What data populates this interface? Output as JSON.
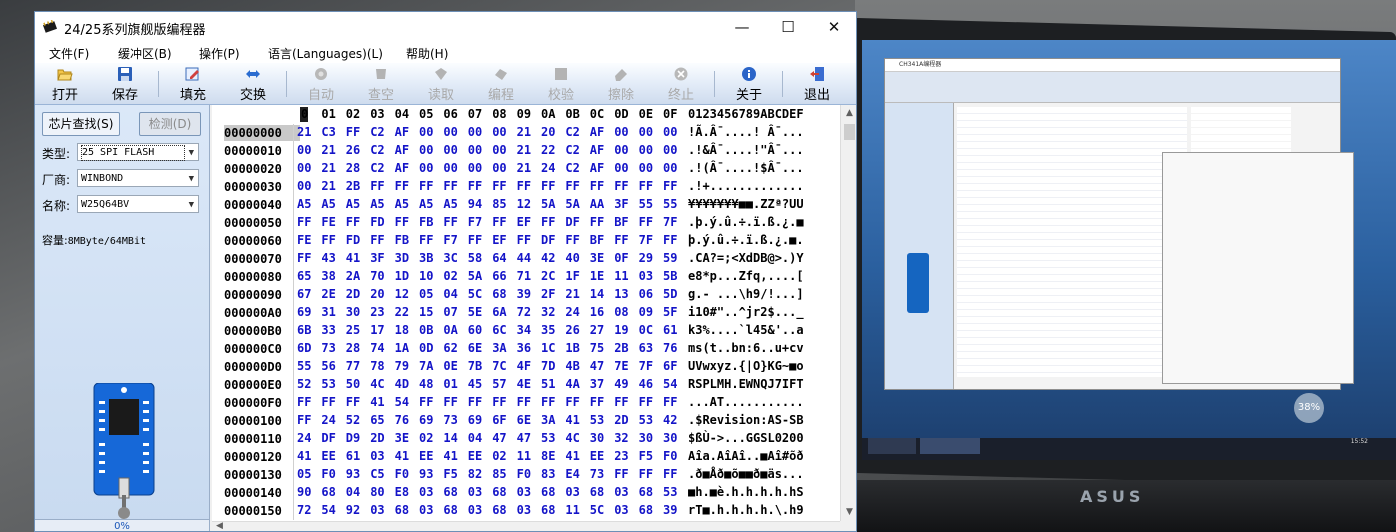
{
  "window": {
    "title": "24/25系列旗舰版编程器",
    "minimize": "—",
    "maximize": "☐",
    "close": "✕"
  },
  "menu": [
    "文件(F)",
    "缓冲区(B)",
    "操作(P)",
    "语言(Languages)(L)",
    "帮助(H)"
  ],
  "toolbar": [
    {
      "label": "打开",
      "icon": "open-folder-icon",
      "enabled": true
    },
    {
      "label": "保存",
      "icon": "save-icon",
      "enabled": true
    },
    {
      "label": "填充",
      "icon": "fill-icon",
      "enabled": true
    },
    {
      "label": "交换",
      "icon": "swap-icon",
      "enabled": true
    },
    {
      "label": "自动",
      "icon": "auto-icon",
      "enabled": false
    },
    {
      "label": "查空",
      "icon": "blank-check-icon",
      "enabled": false
    },
    {
      "label": "读取",
      "icon": "read-icon",
      "enabled": false
    },
    {
      "label": "编程",
      "icon": "program-icon",
      "enabled": false
    },
    {
      "label": "校验",
      "icon": "verify-icon",
      "enabled": false
    },
    {
      "label": "擦除",
      "icon": "erase-icon",
      "enabled": false
    },
    {
      "label": "终止",
      "icon": "stop-icon",
      "enabled": false
    },
    {
      "label": "关于",
      "icon": "info-icon",
      "enabled": true
    },
    {
      "label": "退出",
      "icon": "exit-icon",
      "enabled": true
    }
  ],
  "left_panel": {
    "search_button": "芯片查找(S)",
    "detect_button": "检测(D)",
    "type_label": "类型:",
    "type_value": "25 SPI FLASH",
    "vendor_label": "厂商:",
    "vendor_value": "WINBOND",
    "name_label": "名称:",
    "name_value": "W25Q64BV",
    "capacity_label": "容量:",
    "capacity_value": "8MByte/64MBit",
    "progress": "0%"
  },
  "hex": {
    "columns": [
      "0",
      "01",
      "02",
      "03",
      "04",
      "05",
      "06",
      "07",
      "08",
      "09",
      "0A",
      "0B",
      "0C",
      "0D",
      "0E",
      "0F"
    ],
    "ascii_header": "0123456789ABCDEF",
    "selected_address": "00000000",
    "rows": [
      {
        "addr": "00000000",
        "bytes": "21 C3 FF C2 AF 00 00 00 00 21 20 C2 AF 00 00 00",
        "ascii": "!Ã.Â¯....! Â¯..."
      },
      {
        "addr": "00000010",
        "bytes": "00 21 26 C2 AF 00 00 00 00 21 22 C2 AF 00 00 00",
        "ascii": ".!&Â¯....!\"Â¯..."
      },
      {
        "addr": "00000020",
        "bytes": "00 21 28 C2 AF 00 00 00 00 21 24 C2 AF 00 00 00",
        "ascii": ".!(Â¯....!$Â¯..."
      },
      {
        "addr": "00000030",
        "bytes": "00 21 2B FF FF FF FF FF FF FF FF FF FF FF FF FF",
        "ascii": ".!+............."
      },
      {
        "addr": "00000040",
        "bytes": "A5 A5 A5 A5 A5 A5 A5 94 85 12 5A 5A AA 3F 55 55",
        "ascii": "¥¥¥¥¥¥¥■■.ZZª?UU"
      },
      {
        "addr": "00000050",
        "bytes": "FF FE FF FD FF FB FF F7 FF EF FF DF FF BF FF 7F",
        "ascii": ".þ.ý.û.÷.ï.ß.¿.■"
      },
      {
        "addr": "00000060",
        "bytes": "FE FF FD FF FB FF F7 FF EF FF DF FF BF FF 7F FF",
        "ascii": "þ.ý.û.÷.ï.ß.¿.■."
      },
      {
        "addr": "00000070",
        "bytes": "FF 43 41 3F 3D 3B 3C 58 64 44 42 40 3E 0F 29 59",
        "ascii": ".CA?=;<XdDB@>.)Y"
      },
      {
        "addr": "00000080",
        "bytes": "65 38 2A 70 1D 10 02 5A 66 71 2C 1F 1E 11 03 5B",
        "ascii": "e8*p...Zfq,....["
      },
      {
        "addr": "00000090",
        "bytes": "67 2E 2D 20 12 05 04 5C 68 39 2F 21 14 13 06 5D",
        "ascii": "g.- ...\\h9/!...]"
      },
      {
        "addr": "000000A0",
        "bytes": "69 31 30 23 22 15 07 5E 6A 72 32 24 16 08 09 5F",
        "ascii": "i10#\"..^jr2$..._"
      },
      {
        "addr": "000000B0",
        "bytes": "6B 33 25 17 18 0B 0A 60 6C 34 35 26 27 19 0C 61",
        "ascii": "k3%....`l45&'..a"
      },
      {
        "addr": "000000C0",
        "bytes": "6D 73 28 74 1A 0D 62 6E 3A 36 1C 1B 75 2B 63 76",
        "ascii": "ms(t..bn:6..u+cv"
      },
      {
        "addr": "000000D0",
        "bytes": "55 56 77 78 79 7A 0E 7B 7C 4F 7D 4B 47 7E 7F 6F",
        "ascii": "UVwxyz.{|O}KG~■o"
      },
      {
        "addr": "000000E0",
        "bytes": "52 53 50 4C 4D 48 01 45 57 4E 51 4A 37 49 46 54",
        "ascii": "RSPLMH.EWNQJ7IFT"
      },
      {
        "addr": "000000F0",
        "bytes": "FF FF FF 41 54 FF FF FF FF FF FF FF FF FF FF FF",
        "ascii": "...AT..........."
      },
      {
        "addr": "00000100",
        "bytes": "FF 24 52 65 76 69 73 69 6F 6E 3A 41 53 2D 53 42",
        "ascii": ".$Revision:AS-SB"
      },
      {
        "addr": "00000110",
        "bytes": "24 DF D9 2D 3E 02 14 04 47 47 53 4C 30 32 30 30",
        "ascii": "$ßÙ->...GGSL0200"
      },
      {
        "addr": "00000120",
        "bytes": "41 EE 61 03 41 EE 41 EE 02 11 8E 41 EE 23 F5 F0",
        "ascii": "Aîa.AîAî..■Aî#õð"
      },
      {
        "addr": "00000130",
        "bytes": "05 F0 93 C5 F0 93 F5 82 85 F0 83 E4 73 FF FF FF",
        "ascii": ".ð■Åð■õ■■ð■äs..."
      },
      {
        "addr": "00000140",
        "bytes": "90 68 04 80 E8 03 68 03 68 03 68 03 68 03 68 53",
        "ascii": "■h.■è.h.h.h.h.hS"
      },
      {
        "addr": "00000150",
        "bytes": "72 54 92 03 68 03 68 03 68 03 68 11 5C 03 68 39",
        "ascii": "rT■.h.h.h.h.\\.h9"
      }
    ]
  },
  "laptop_screen": {
    "window_title": "CH341A编程器",
    "clock": "15:52",
    "badge": "38%"
  },
  "laptop_logo": "ASUS"
}
